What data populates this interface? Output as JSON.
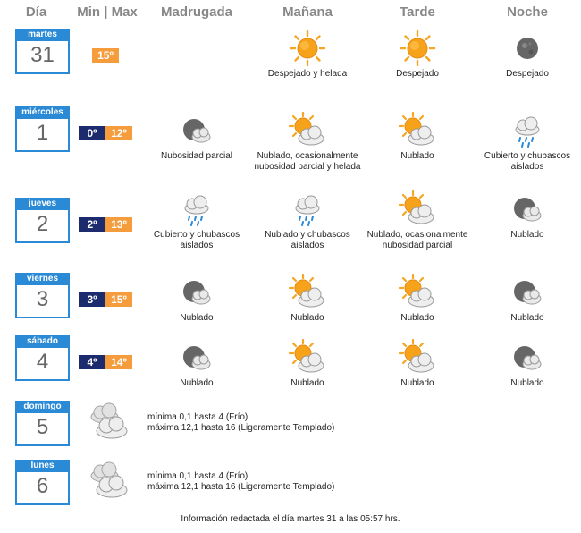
{
  "headers": {
    "dia": "Día",
    "minmax": "Min | Max",
    "madrugada": "Madrugada",
    "manana": "Mañana",
    "tarde": "Tarde",
    "noche": "Noche"
  },
  "days": [
    {
      "weekday": "martes",
      "day": "31",
      "min": "",
      "max": "15º",
      "madrugada": {
        "icon": "",
        "desc": ""
      },
      "manana": {
        "icon": "sun-icon",
        "desc": "Despejado y helada"
      },
      "tarde": {
        "icon": "sun-icon",
        "desc": "Despejado"
      },
      "noche": {
        "icon": "moon-icon",
        "desc": "Despejado"
      }
    },
    {
      "weekday": "miércoles",
      "day": "1",
      "min": "0º",
      "max": "12º",
      "madrugada": {
        "icon": "moon-cloud-icon",
        "desc": "Nubosidad parcial"
      },
      "manana": {
        "icon": "sun-cloud-icon",
        "desc": "Nublado, ocasionalmente nubosidad parcial y helada"
      },
      "tarde": {
        "icon": "sun-cloud-icon",
        "desc": "Nublado"
      },
      "noche": {
        "icon": "rain-cloud-icon",
        "desc": "Cubierto y chubascos aislados"
      }
    },
    {
      "weekday": "jueves",
      "day": "2",
      "min": "2º",
      "max": "13º",
      "madrugada": {
        "icon": "rain-cloud-icon",
        "desc": "Cubierto y chubascos aislados"
      },
      "manana": {
        "icon": "rain-cloud-icon",
        "desc": "Nublado y chubascos aislados"
      },
      "tarde": {
        "icon": "sun-cloud-icon",
        "desc": "Nublado, ocasionalmente nubosidad parcial"
      },
      "noche": {
        "icon": "moon-cloud-icon",
        "desc": "Nublado"
      }
    },
    {
      "weekday": "viernes",
      "day": "3",
      "min": "3º",
      "max": "15º",
      "madrugada": {
        "icon": "moon-cloud-icon",
        "desc": "Nublado"
      },
      "manana": {
        "icon": "sun-cloud-icon",
        "desc": "Nublado"
      },
      "tarde": {
        "icon": "sun-cloud-icon",
        "desc": "Nublado"
      },
      "noche": {
        "icon": "moon-cloud-icon",
        "desc": "Nublado"
      }
    },
    {
      "weekday": "sábado",
      "day": "4",
      "min": "4º",
      "max": "14º",
      "madrugada": {
        "icon": "moon-cloud-icon",
        "desc": "Nublado"
      },
      "manana": {
        "icon": "sun-cloud-icon",
        "desc": "Nublado"
      },
      "tarde": {
        "icon": "sun-cloud-icon",
        "desc": "Nublado"
      },
      "noche": {
        "icon": "moon-cloud-icon",
        "desc": "Nublado"
      }
    }
  ],
  "extended": [
    {
      "weekday": "domingo",
      "day": "5",
      "icon": "cloudy-icon",
      "min_text": "mínima 0,1 hasta 4 (Frío)",
      "max_text": "máxima 12,1 hasta 16 (Ligeramente Templado)"
    },
    {
      "weekday": "lunes",
      "day": "6",
      "icon": "cloudy-icon",
      "min_text": "mínima 0,1 hasta 4 (Frío)",
      "max_text": "máxima 12,1 hasta 16 (Ligeramente Templado)"
    }
  ],
  "footer": "Información redactada el día martes 31 a las 05:57 hrs.",
  "colors": {
    "calendar_blue": "#2a8ad6",
    "min_bg": "#1c2a6e",
    "max_bg": "#f59c3c",
    "sun": "#f5a623"
  }
}
